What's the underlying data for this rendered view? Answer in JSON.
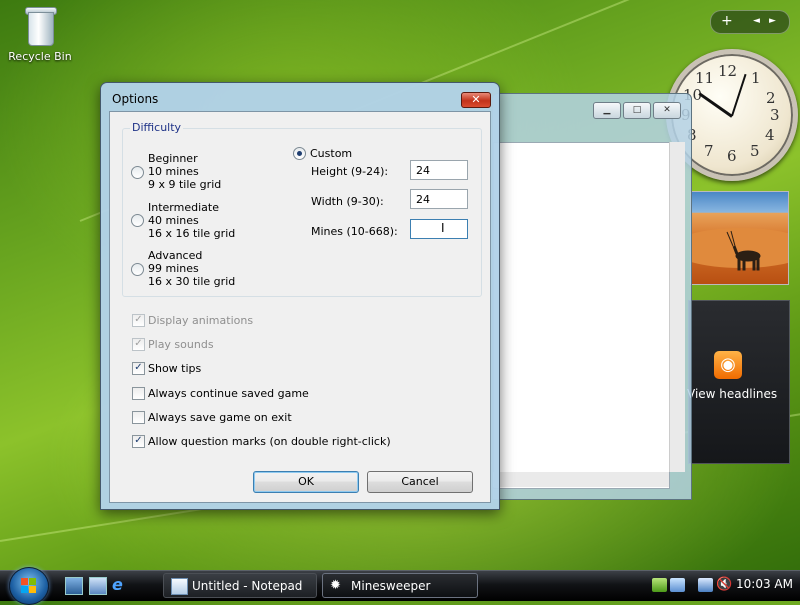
{
  "desktop": {
    "recycle_bin_label": "Recycle Bin"
  },
  "sidebar": {
    "add_gadget": "+",
    "prev": "◄",
    "next": "►",
    "clock_numbers": [
      "12",
      "1",
      "2",
      "3",
      "4",
      "5",
      "6",
      "7",
      "8",
      "9",
      "10",
      "11"
    ],
    "feed_text": "View headlines"
  },
  "background_window": {
    "minimize": "▁",
    "maximize": "□",
    "close": "✕"
  },
  "dialog": {
    "title": "Options",
    "close_label": "✕",
    "difficulty": {
      "legend": "Difficulty",
      "beginner": {
        "name": "Beginner",
        "mines": "10 mines",
        "grid": "9 x 9 tile grid"
      },
      "intermediate": {
        "name": "Intermediate",
        "mines": "40 mines",
        "grid": "16 x 16 tile grid"
      },
      "advanced": {
        "name": "Advanced",
        "mines": "99 mines",
        "grid": "16 x 30 tile grid"
      },
      "custom": {
        "name": "Custom",
        "selected": true,
        "height_label": "Height (9-24):",
        "height_value": "24",
        "width_label": "Width (9-30):",
        "width_value": "24",
        "mines_label": "Mines (10-668):",
        "mines_value": ""
      }
    },
    "options": [
      {
        "label": "Display animations",
        "checked": true,
        "enabled": false
      },
      {
        "label": "Play sounds",
        "checked": true,
        "enabled": false
      },
      {
        "label": "Show tips",
        "checked": true,
        "enabled": true
      },
      {
        "label": "Always continue saved game",
        "checked": false,
        "enabled": true
      },
      {
        "label": "Always save game on exit",
        "checked": false,
        "enabled": true
      },
      {
        "label": "Allow question marks (on double right-click)",
        "checked": true,
        "enabled": true
      }
    ],
    "ok_label": "OK",
    "cancel_label": "Cancel"
  },
  "taskbar": {
    "tasks": [
      {
        "label": "Untitled - Notepad"
      },
      {
        "label": "Minesweeper"
      }
    ],
    "time": "10:03 AM"
  }
}
